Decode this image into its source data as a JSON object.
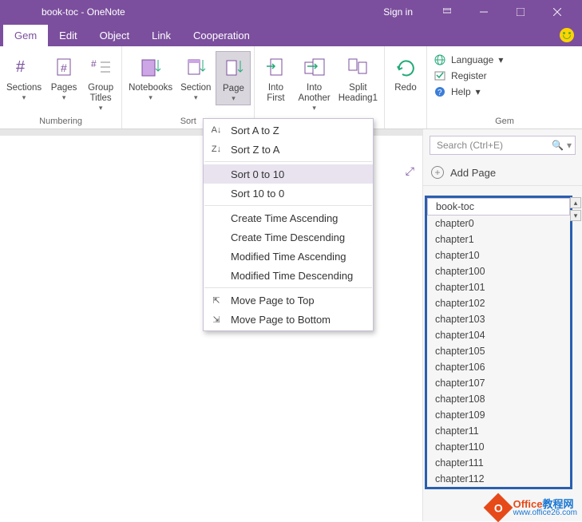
{
  "window": {
    "title": "book-toc  -  OneNote",
    "signin": "Sign in"
  },
  "tabs": [
    "Gem",
    "Edit",
    "Object",
    "Link",
    "Cooperation"
  ],
  "ribbon": {
    "groups": {
      "numbering": {
        "label": "Numbering",
        "sections": "Sections",
        "pages": "Pages",
        "group_titles": "Group\nTitles"
      },
      "sort": {
        "label": "Sort",
        "notebooks": "Notebooks",
        "section": "Section",
        "page": "Page"
      },
      "into": {
        "into_first": "Into\nFirst",
        "into_another": "Into\nAnother",
        "split": "Split\nHeading1"
      },
      "redo": {
        "label": "Redo"
      },
      "gem": {
        "label": "Gem",
        "language": "Language",
        "register": "Register",
        "help": "Help"
      }
    }
  },
  "dropdown": {
    "items": [
      "Sort A to Z",
      "Sort Z to A",
      "Sort 0 to 10",
      "Sort 10 to 0",
      "Create Time Ascending",
      "Create Time Descending",
      "Modified Time Ascending",
      "Modified Time Descending",
      "Move Page to Top",
      "Move Page to Bottom"
    ],
    "highlighted_index": 2
  },
  "side": {
    "search_placeholder": "Search (Ctrl+E)",
    "add_page": "Add Page",
    "pages": [
      "book-toc",
      "chapter0",
      "chapter1",
      "chapter10",
      "chapter100",
      "chapter101",
      "chapter102",
      "chapter103",
      "chapter104",
      "chapter105",
      "chapter106",
      "chapter107",
      "chapter108",
      "chapter109",
      "chapter11",
      "chapter110",
      "chapter111",
      "chapter112"
    ],
    "selected_index": 0
  },
  "watermark": {
    "brand": "Office",
    "suffix": "教程网",
    "url": "www.office26.com"
  }
}
